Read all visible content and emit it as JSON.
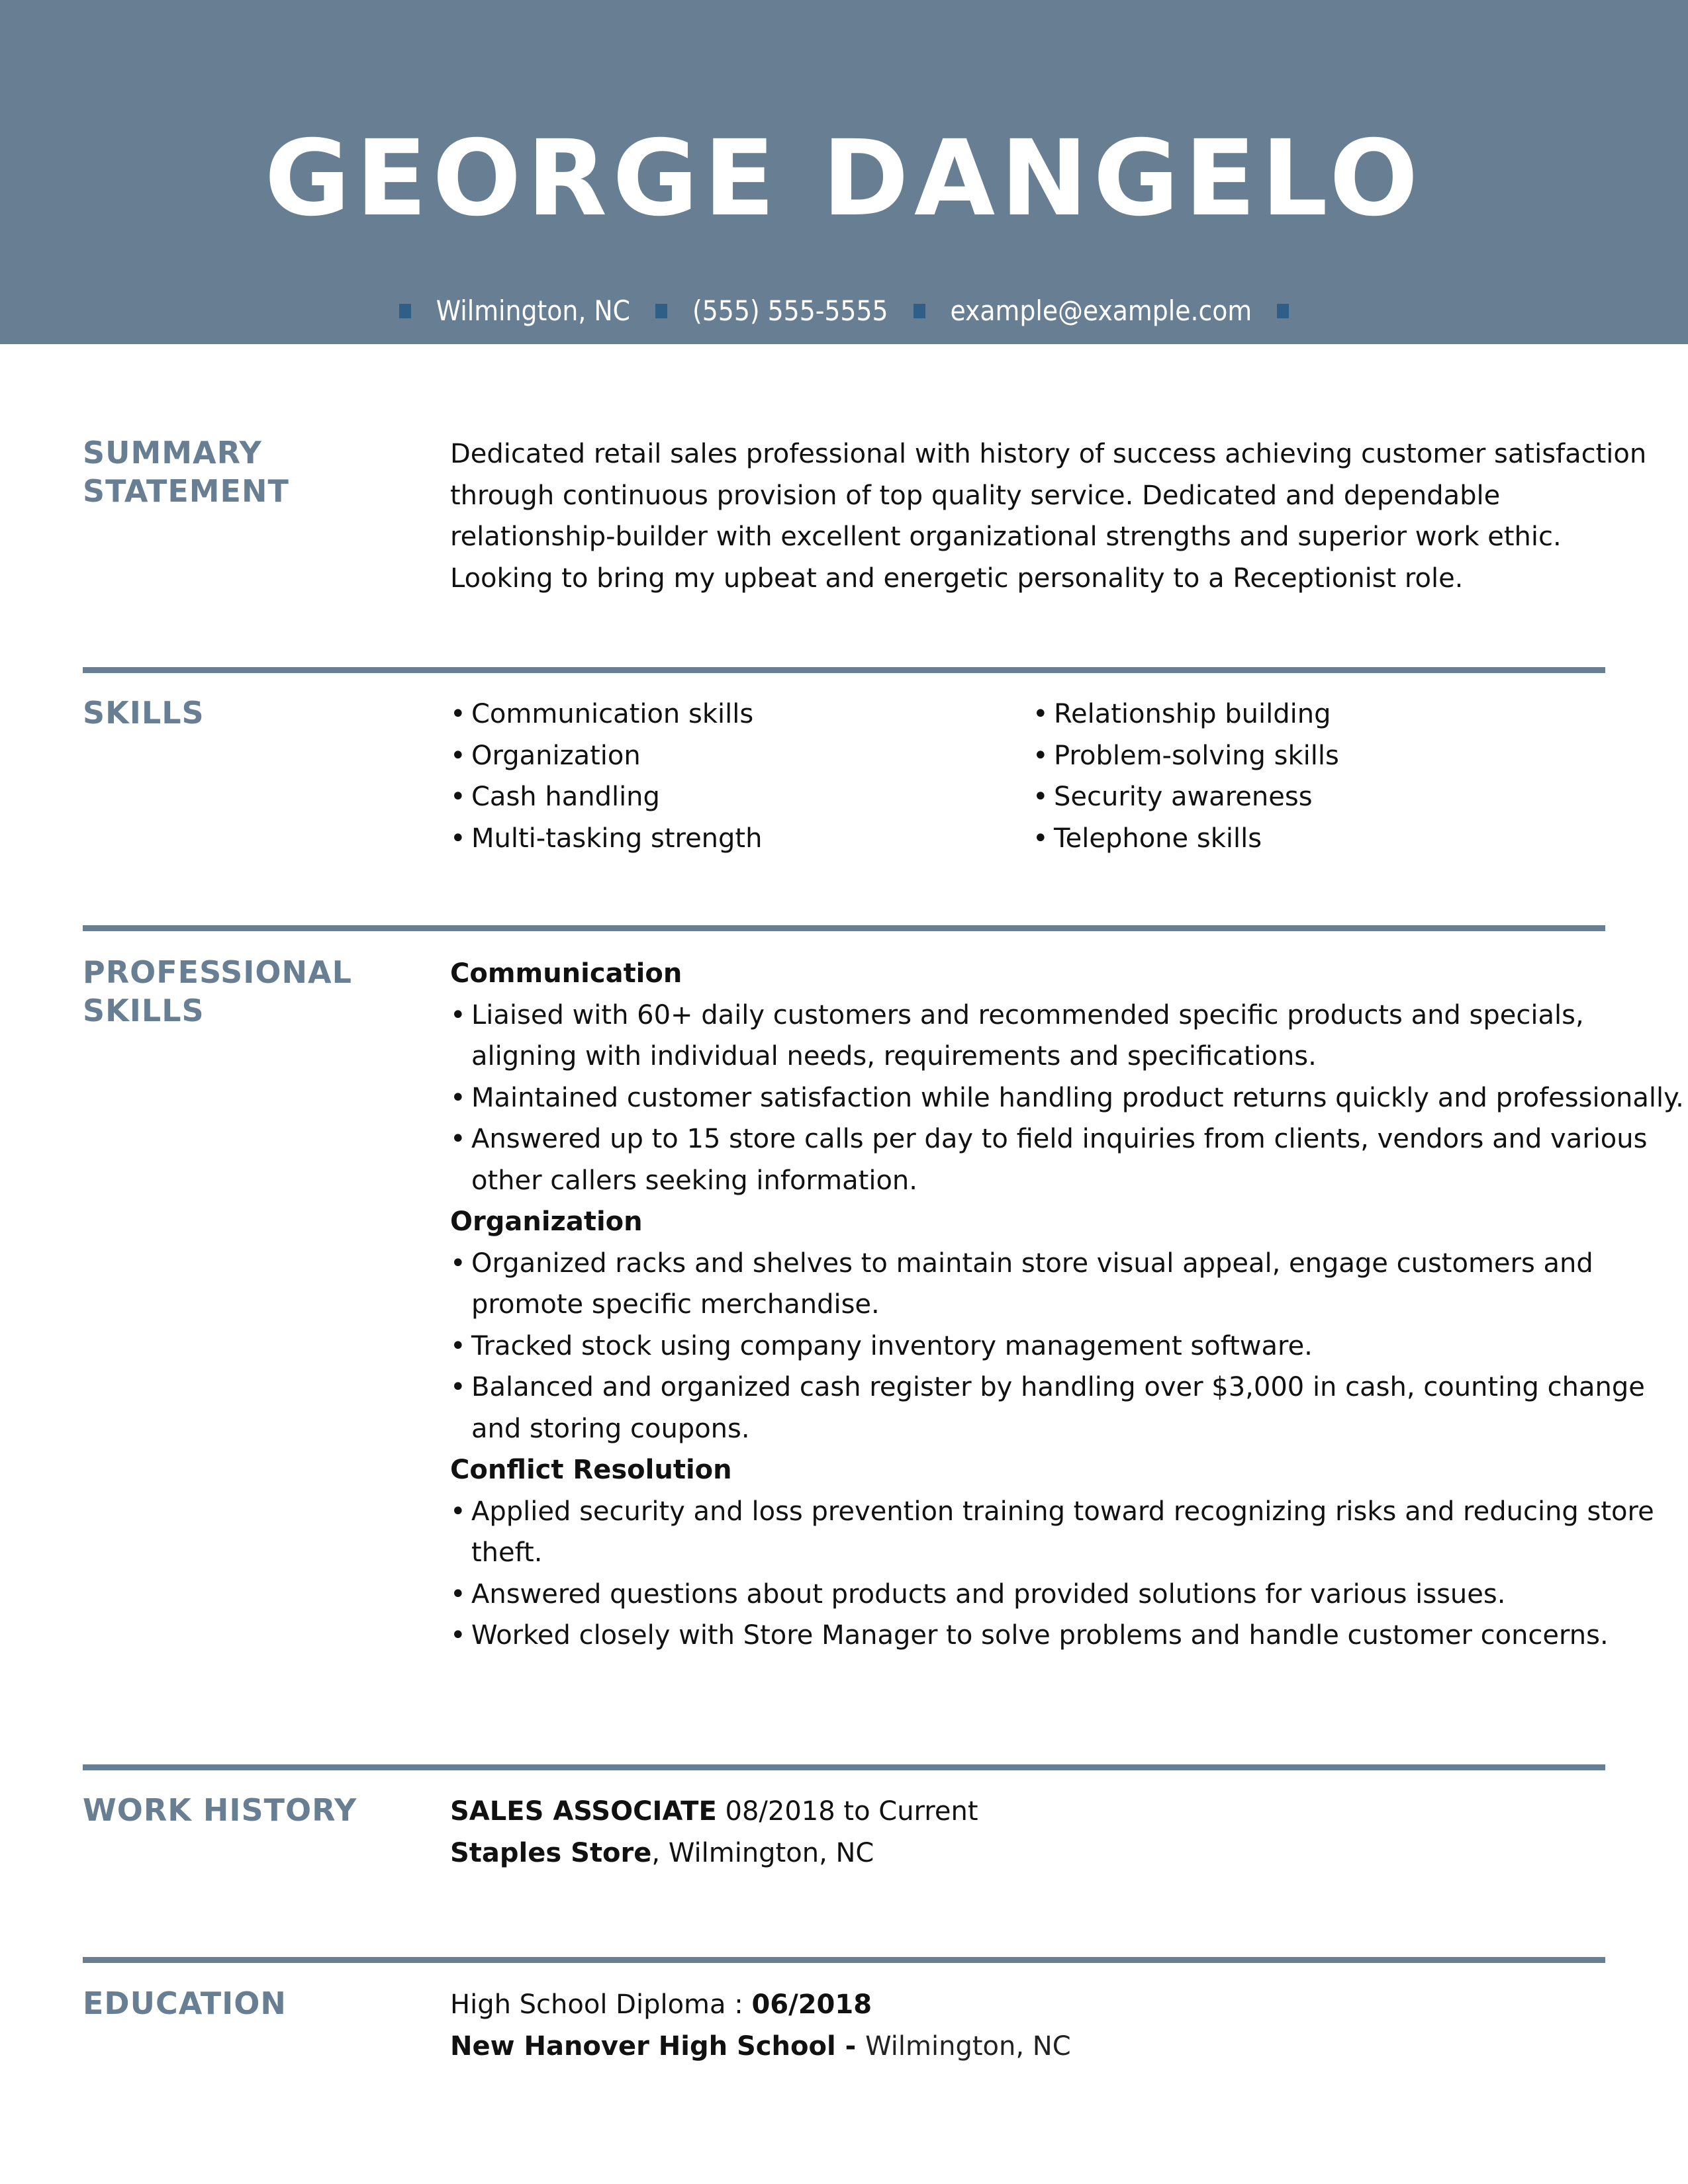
{
  "header": {
    "name": "GEORGE DANGELO",
    "contact": {
      "location": "Wilmington, NC",
      "phone": "(555) 555-5555",
      "email": "example@example.com"
    },
    "colors": {
      "band": "#687f93",
      "separator": "#2f5f86"
    }
  },
  "summary": {
    "title_line1": "SUMMARY",
    "title_line2": "STATEMENT",
    "lines": [
      "Dedicated retail sales professional with history of success achieving customer satisfaction",
      "through continuous provision of top quality service. Dedicated and dependable",
      "relationship-builder with excellent organizational strengths and superior work ethic.",
      "Looking to bring my upbeat and energetic personality to a Receptionist role."
    ]
  },
  "skills": {
    "title": "SKILLS",
    "bullet": "•",
    "left": [
      "Communication skills",
      "Organization",
      "Cash handling",
      "Multi-tasking strength"
    ],
    "right": [
      "Relationship building",
      "Problem-solving skills",
      "Security awareness",
      "Telephone skills"
    ]
  },
  "professional_skills": {
    "title_line1": "PROFESSIONAL",
    "title_line2": "SKILLS",
    "groups": [
      {
        "title": "Communication",
        "items": [
          "Liaised with 60+ daily customers and recommended specific products and specials, aligning with individual needs, requirements and specifications.",
          "Maintained customer satisfaction while handling product returns quickly and professionally.",
          "Answered up to 15 store calls per day to field inquiries from clients, vendors and various other callers seeking information."
        ]
      },
      {
        "title": "Organization",
        "items": [
          "Organized racks and shelves to maintain store visual appeal, engage customers and promote specific merchandise.",
          "Tracked stock using company inventory management software.",
          "Balanced and organized cash register by handling over $3,000 in cash, counting change and storing coupons."
        ]
      },
      {
        "title": "Conflict Resolution",
        "items": [
          "Applied security and loss prevention training toward recognizing risks and reducing store theft.",
          "Answered questions about products and provided solutions for various issues.",
          "Worked closely with Store Manager to solve problems and handle customer concerns."
        ]
      }
    ]
  },
  "work_history": {
    "title": "WORK HISTORY",
    "job_title": "SALES ASSOCIATE",
    "dates": "08/2018 to Current",
    "company": "Staples Store",
    "location": ", Wilmington, NC"
  },
  "education": {
    "title": "EDUCATION",
    "degree": "High School Diploma : ",
    "date": "06/2018",
    "school": "New Hanover High School - ",
    "location": "Wilmington, NC"
  }
}
